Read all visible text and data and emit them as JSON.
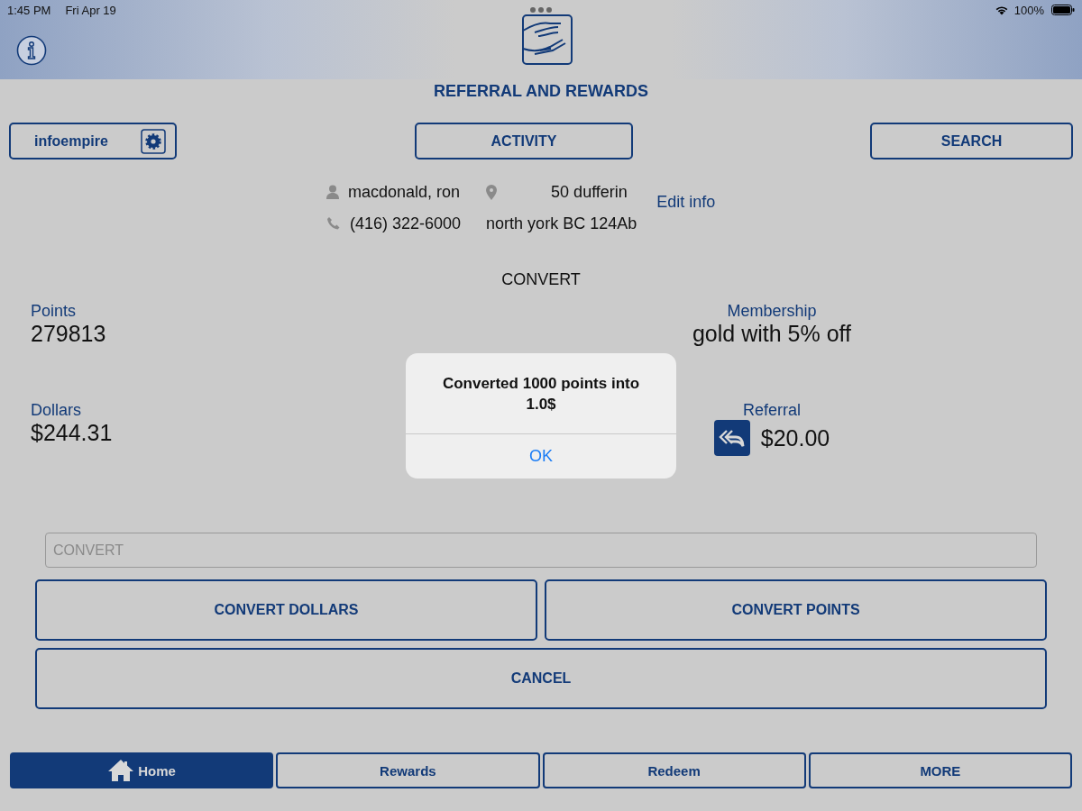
{
  "status_bar": {
    "time": "1:45 PM",
    "date": "Fri Apr 19",
    "battery": "100%"
  },
  "header": {
    "title": "REFERRAL AND REWARDS"
  },
  "toolbar": {
    "account": "infoempire",
    "activity": "ACTIVITY",
    "search": "SEARCH"
  },
  "contact": {
    "name": "macdonald, ron",
    "address_line_1": "50 dufferin",
    "phone": "(416) 322-6000",
    "address_line_2": "north york BC 124Ab",
    "edit_link": "Edit info"
  },
  "section_title": "CONVERT",
  "stats": {
    "points_label": "Points",
    "points": "279813",
    "membership_label": "Membership",
    "membership": "gold with 5% off",
    "dollars_label": "Dollars",
    "dollars": "$244.31",
    "referral_label": "Referral",
    "referral": "$20.00"
  },
  "convert_field": {
    "placeholder": "CONVERT"
  },
  "buttons": {
    "convert_dollars": "CONVERT DOLLARS",
    "convert_points": "CONVERT POINTS",
    "cancel": "CANCEL"
  },
  "tabs": [
    {
      "label": "Home",
      "kind": "icon",
      "selected": true
    },
    {
      "label": "Rewards",
      "kind": "text",
      "selected": false
    },
    {
      "label": "Redeem",
      "kind": "text",
      "selected": false
    },
    {
      "label": "MORE",
      "kind": "text",
      "selected": false
    }
  ],
  "alert": {
    "message": "Converted 1000 points into 1.0$",
    "button": "OK"
  }
}
